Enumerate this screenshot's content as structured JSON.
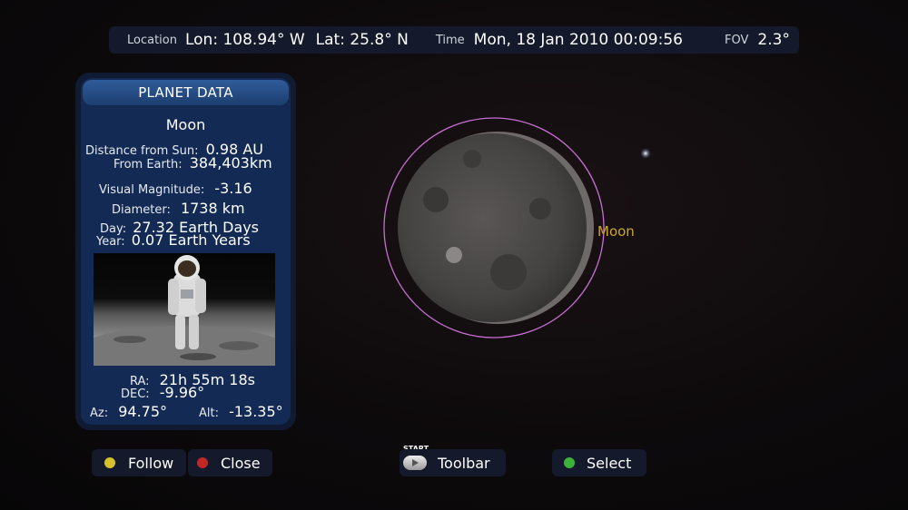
{
  "topbar": {
    "location_label": "Location",
    "lon": "Lon: 108.94° W",
    "lat": "Lat: 25.8° N",
    "time_label": "Time",
    "time": "Mon, 18 Jan 2010 00:09:56",
    "fov_label": "FOV",
    "fov": "2.3°"
  },
  "panel": {
    "header": "PLANET DATA",
    "name": "Moon",
    "dist_sun_label": "Distance from Sun:",
    "dist_sun": "0.98 AU",
    "dist_earth_label": "From Earth:",
    "dist_earth": "384,403km",
    "mag_label": "Visual Magnitude:",
    "mag": "-3.16",
    "diam_label": "Diameter:",
    "diam": "1738 km",
    "day_label": "Day:",
    "day": "27.32 Earth Days",
    "year_label": "Year:",
    "year": "0.07 Earth Years",
    "ra_label": "RA:",
    "ra": "21h 55m 18s",
    "dec_label": "DEC:",
    "dec": "-9.96°",
    "az_label": "Az:",
    "az": "94.75°",
    "alt_label": "Alt:",
    "alt": "-13.35°"
  },
  "sky": {
    "moon_label": "Moon",
    "label_color": "#c9a82a",
    "ring_color": "#c56fd0"
  },
  "buttons": {
    "follow": "Follow",
    "close": "Close",
    "start": "START",
    "toolbar": "Toolbar",
    "select": "Select"
  }
}
